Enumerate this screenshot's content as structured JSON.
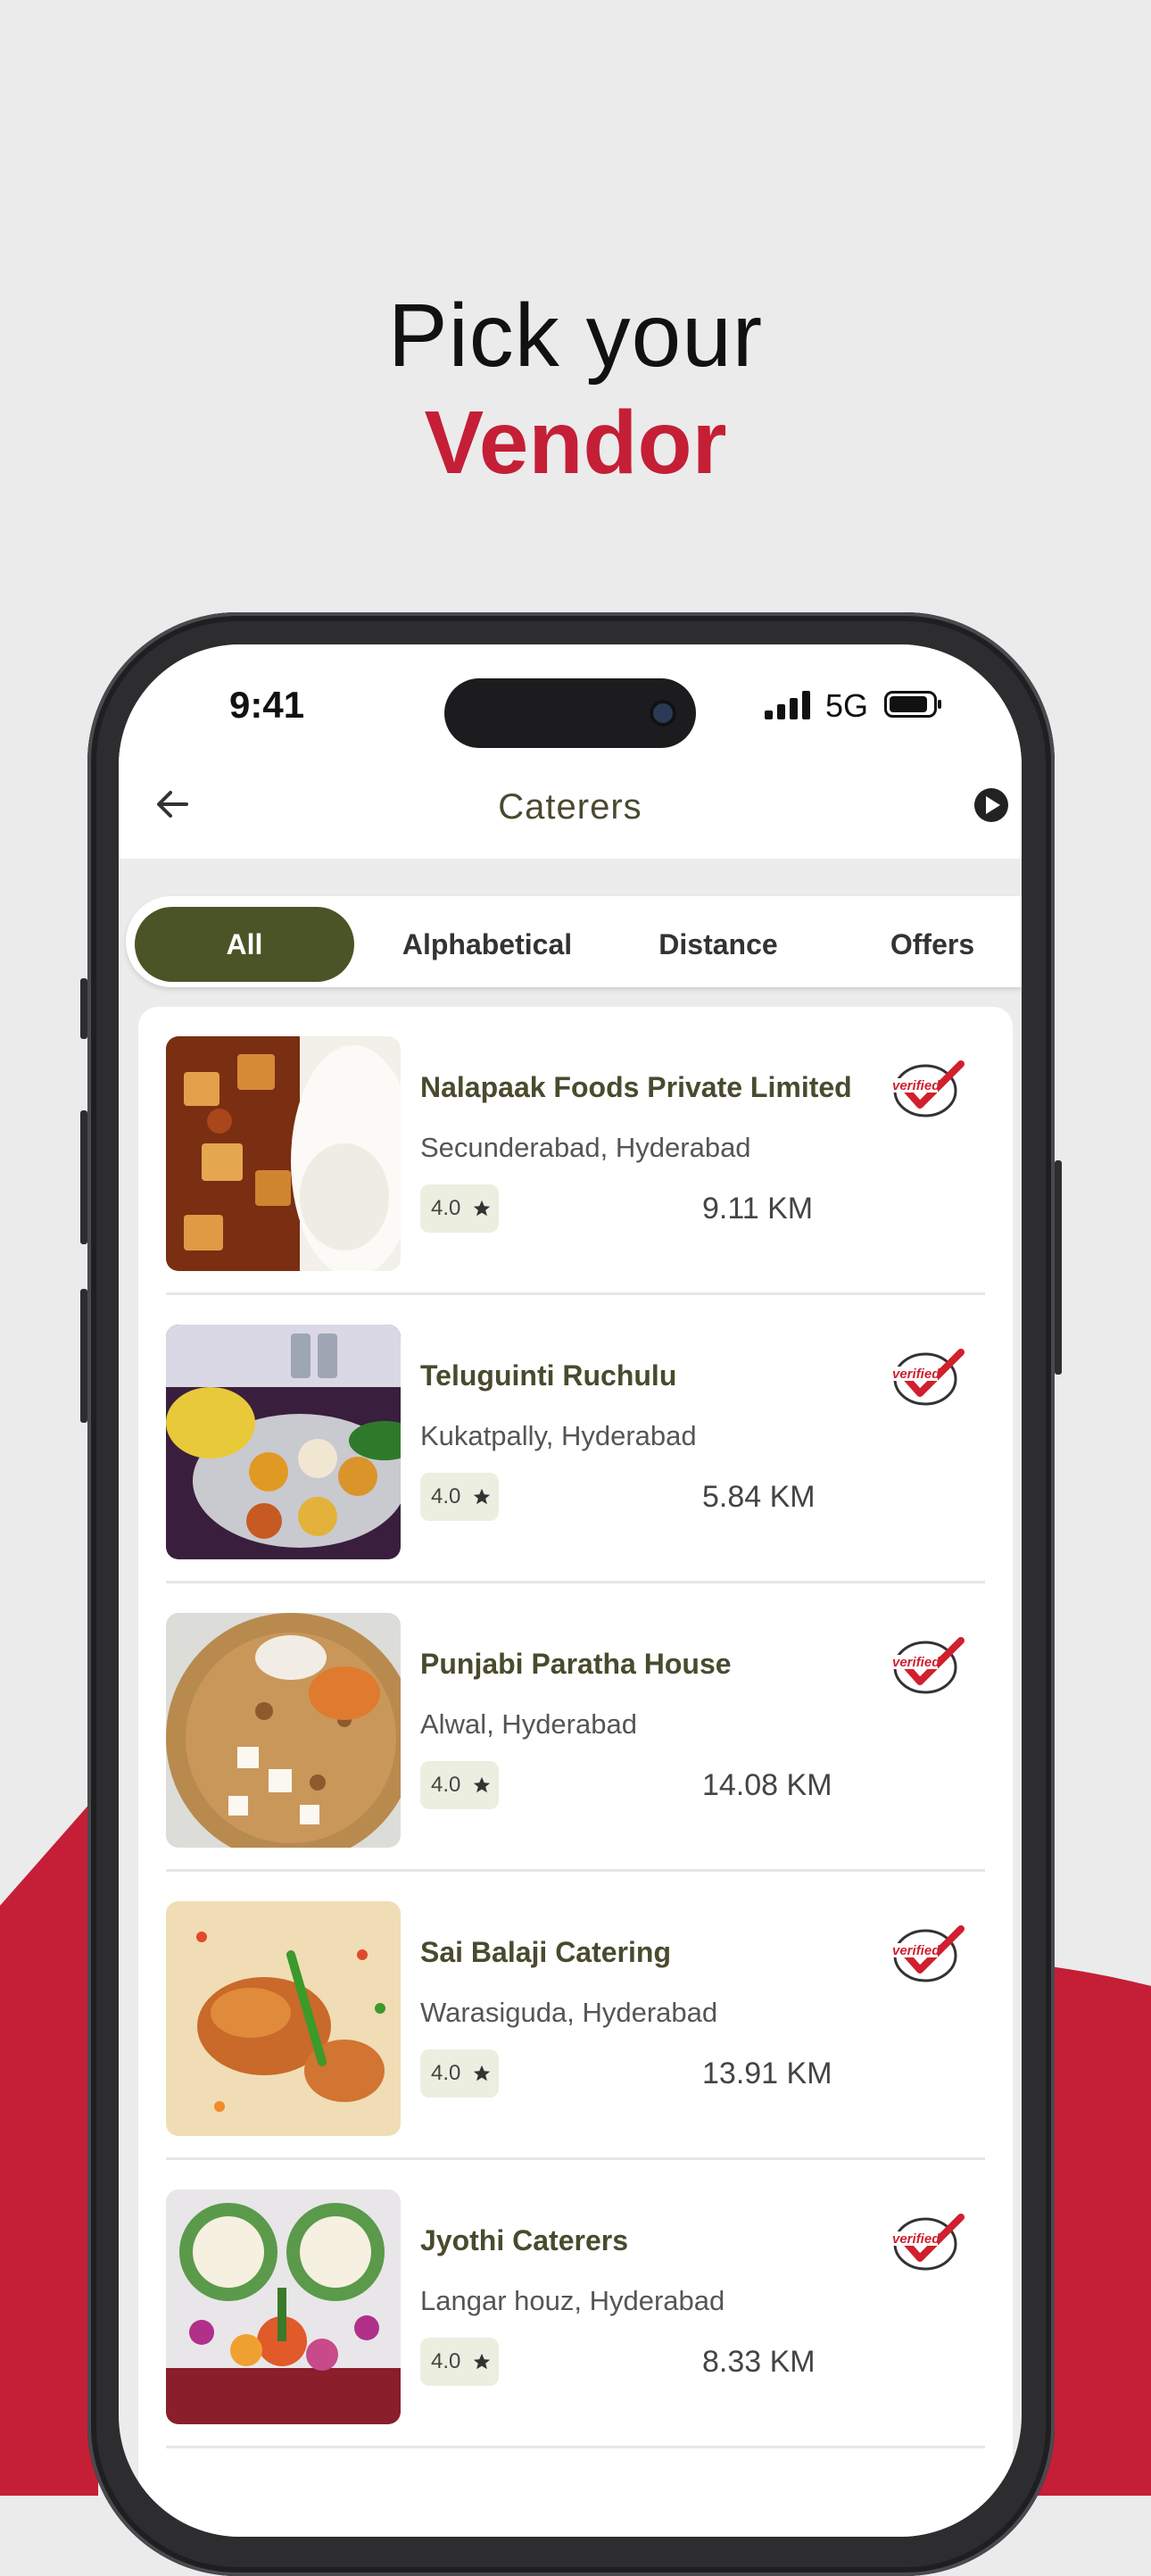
{
  "headline": {
    "line1": "Pick your",
    "line2": "Vendor"
  },
  "colors": {
    "brand_red": "#c41f36",
    "olive": "#4b5426",
    "background": "#ebebeb"
  },
  "status_bar": {
    "time": "9:41",
    "network": "5G"
  },
  "app_bar": {
    "title": "Caterers",
    "back_icon": "arrow-left-icon",
    "action_icon": "play-circle-icon"
  },
  "tabs": [
    {
      "label": "All",
      "active": true
    },
    {
      "label": "Alphabetical",
      "active": false
    },
    {
      "label": "Distance",
      "active": false
    },
    {
      "label": "Offers",
      "active": false
    }
  ],
  "vendors": [
    {
      "name": "Nalapaak Foods Private Limited",
      "location": "Secunderabad, Hyderabad",
      "rating": "4.0",
      "distance": "9.11 KM",
      "badge": "verified",
      "image": "paneer curry with rice"
    },
    {
      "name": "Teluguinti Ruchulu",
      "location": "Kukatpally, Hyderabad",
      "rating": "4.0",
      "distance": "5.84 KM",
      "badge": "verified",
      "image": "thali platter"
    },
    {
      "name": "Punjabi Paratha House",
      "location": "Alwal, Hyderabad",
      "rating": "4.0",
      "distance": "14.08 KM",
      "badge": "verified",
      "image": "paratha with paneer"
    },
    {
      "name": "Sai Balaji Catering",
      "location": "Warasiguda, Hyderabad",
      "rating": "4.0",
      "distance": "13.91 KM",
      "badge": "verified",
      "image": "chicken biryani"
    },
    {
      "name": "Jyothi Caterers",
      "location": "Langar houz, Hyderabad",
      "rating": "4.0",
      "distance": "8.33 KM",
      "badge": "verified",
      "image": "event decoration"
    }
  ]
}
